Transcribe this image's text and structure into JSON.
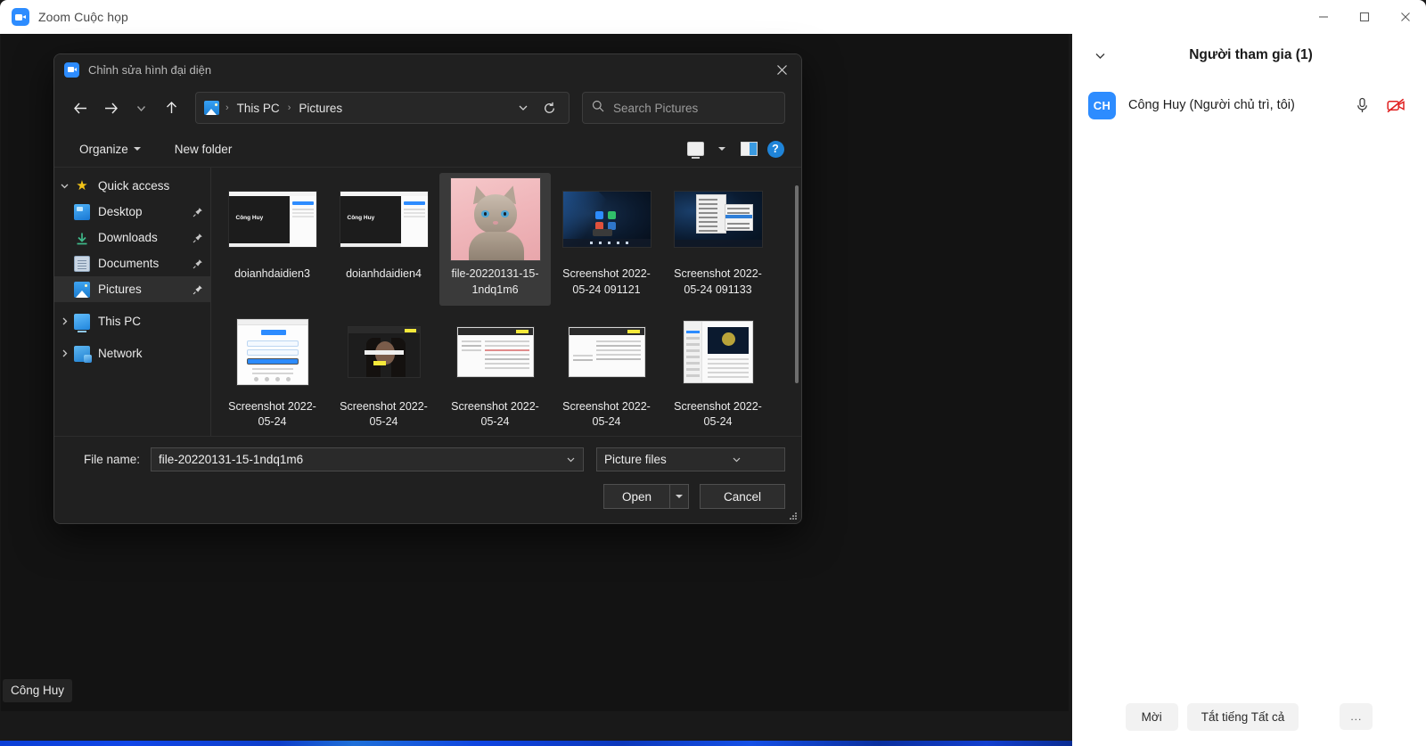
{
  "zoom_window": {
    "title": "Zoom Cuộc họp",
    "app_icon": "zoom-logo-icon",
    "minimize_label": "—",
    "maximize_label": "□",
    "close_label": "✕",
    "video_name_badge": "Công Huy"
  },
  "participants_panel": {
    "collapse_icon": "chevron-down-icon",
    "title": "Người tham gia (1)",
    "people": [
      {
        "initials": "CH",
        "name": "Công Huy (Người chủ trì, tôi)",
        "mic_icon": "microphone-icon",
        "camera_icon": "camera-off-icon"
      }
    ],
    "footer_buttons": [
      {
        "label": "Mời",
        "name": "invite-button"
      },
      {
        "label": "Tắt tiếng Tất cả",
        "name": "mute-all-button"
      },
      {
        "label": "...",
        "name": "more-options-button"
      }
    ]
  },
  "file_dialog": {
    "title": "Chỉnh sửa hình đại diện",
    "app_icon": "zoom-logo-icon",
    "close_label": "✕",
    "nav": {
      "back_icon": "arrow-left-icon",
      "forward_icon": "arrow-right-icon",
      "recent_icon": "chevron-down-icon",
      "up_icon": "arrow-up-icon",
      "path_icon": "pictures-folder-icon",
      "breadcrumbs": [
        "This PC",
        "Pictures"
      ],
      "breadcrumb_separator": "›",
      "dropdown_icon": "chevron-down-icon",
      "refresh_icon": "refresh-icon"
    },
    "search": {
      "icon": "search-icon",
      "placeholder": "Search Pictures",
      "value": ""
    },
    "toolbar": {
      "organize_label": "Organize",
      "new_folder_label": "New folder",
      "view_icon": "view-mode-icon",
      "view_dropdown_icon": "caret-down-icon",
      "preview_pane_icon": "preview-pane-icon",
      "help_icon": "help-icon",
      "help_label": "?"
    },
    "tree": [
      {
        "label": "Quick access",
        "icon": "star-icon",
        "expander": "chevron-down-icon",
        "level": 0,
        "selected": false,
        "pinned": false
      },
      {
        "label": "Desktop",
        "icon": "desktop-icon",
        "expander": "",
        "level": 1,
        "selected": false,
        "pinned": true
      },
      {
        "label": "Downloads",
        "icon": "downloads-icon",
        "expander": "",
        "level": 1,
        "selected": false,
        "pinned": true
      },
      {
        "label": "Documents",
        "icon": "documents-icon",
        "expander": "",
        "level": 1,
        "selected": false,
        "pinned": true
      },
      {
        "label": "Pictures",
        "icon": "pictures-icon",
        "expander": "",
        "level": 1,
        "selected": true,
        "pinned": true
      },
      {
        "label": "This PC",
        "icon": "this-pc-icon",
        "expander": "chevron-right-icon",
        "level": 0,
        "selected": false,
        "pinned": false
      },
      {
        "label": "Network",
        "icon": "network-icon",
        "expander": "chevron-right-icon",
        "level": 0,
        "selected": false,
        "pinned": false
      }
    ],
    "files": [
      {
        "label": "doianhdaidien3",
        "thumb": "zoom-screenshot",
        "selected": false
      },
      {
        "label": "doianhdaidien4",
        "thumb": "zoom-screenshot",
        "selected": false
      },
      {
        "label": "file-20220131-15-1ndq1m6",
        "thumb": "kitten-photo",
        "selected": true
      },
      {
        "label": "Screenshot 2022-05-24 091121",
        "thumb": "dark-desktop",
        "selected": false
      },
      {
        "label": "Screenshot 2022-05-24 091133",
        "thumb": "menu-desktop",
        "selected": false
      },
      {
        "label": "Screenshot 2022-05-24",
        "thumb": "white-login",
        "selected": false
      },
      {
        "label": "Screenshot 2022-05-24",
        "thumb": "person-video",
        "selected": false
      },
      {
        "label": "Screenshot 2022-05-24",
        "thumb": "doc-page",
        "selected": false
      },
      {
        "label": "Screenshot 2022-05-24",
        "thumb": "doc-page",
        "selected": false
      },
      {
        "label": "Screenshot 2022-05-24",
        "thumb": "profile-page",
        "selected": false
      }
    ],
    "footer": {
      "file_name_label": "File name:",
      "file_name_value": "file-20220131-15-1ndq1m6",
      "file_name_placeholder": "File name",
      "file_type_value": "Picture files",
      "file_type_dropdown_icon": "chevron-down-icon",
      "open_label": "Open",
      "open_split_icon": "caret-down-icon",
      "cancel_label": "Cancel",
      "resize_grip": "resize-grip-icon"
    }
  },
  "colors": {
    "zoom_blue": "#2d8cff",
    "dialog_bg": "#202020",
    "selection_bg": "#3a3a3a",
    "panel_bg": "#ffffff",
    "camera_off_red": "#e02020"
  }
}
